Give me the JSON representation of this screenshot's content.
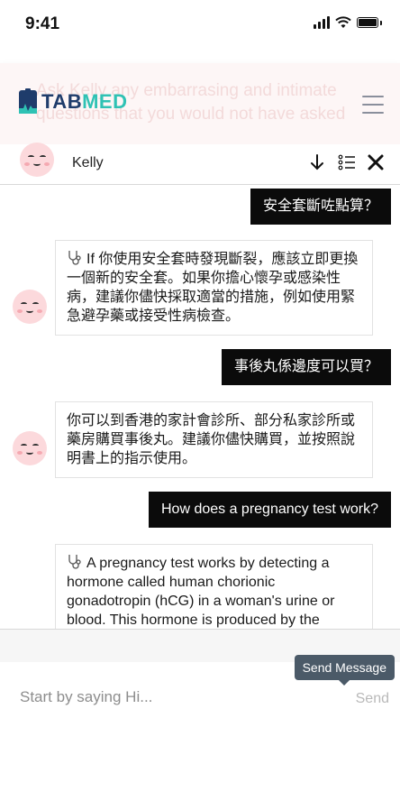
{
  "status_bar": {
    "time": "9:41"
  },
  "header": {
    "logo_tab": "TAB",
    "logo_med": "MED",
    "overlay_text": "Ask Kelly any embarrasing and intimate questions that you would not have asked",
    "brand_colors": {
      "navy": "#1f3c6b",
      "teal": "#2fc2b4"
    }
  },
  "chat": {
    "bot_name": "Kelly",
    "icons": {
      "scroll_down": "arrow-down-icon",
      "list": "list-icon",
      "close": "close-icon"
    }
  },
  "messages": [
    {
      "role": "user",
      "text": "安全套斷咗點算？"
    },
    {
      "role": "bot",
      "icon": "stethoscope-icon",
      "text": "If 你使用安全套時發現斷裂，應該立即更換一個新的安全套。如果你擔心懷孕或感染性病，建議你儘快採取適當的措施，例如使用緊急避孕藥或接受性病檢查。"
    },
    {
      "role": "user",
      "text": "事後丸係邊度可以買？"
    },
    {
      "role": "bot",
      "text": "你可以到香港的家計會診所、部分私家診所或藥房購買事後丸。建議你儘快購買，並按照說明書上的指示使用。"
    },
    {
      "role": "user",
      "text": "How does a pregnancy test work?"
    },
    {
      "role": "bot",
      "icon": "stethoscope-icon",
      "text": "A pregnancy test works by detecting a hormone called human chorionic gonadotropin (hCG) in a woman's urine or blood. This hormone is produced by the"
    }
  ],
  "composer": {
    "placeholder": "Start by saying Hi...",
    "value": "",
    "send_label": "Send",
    "tooltip": "Send Message"
  }
}
